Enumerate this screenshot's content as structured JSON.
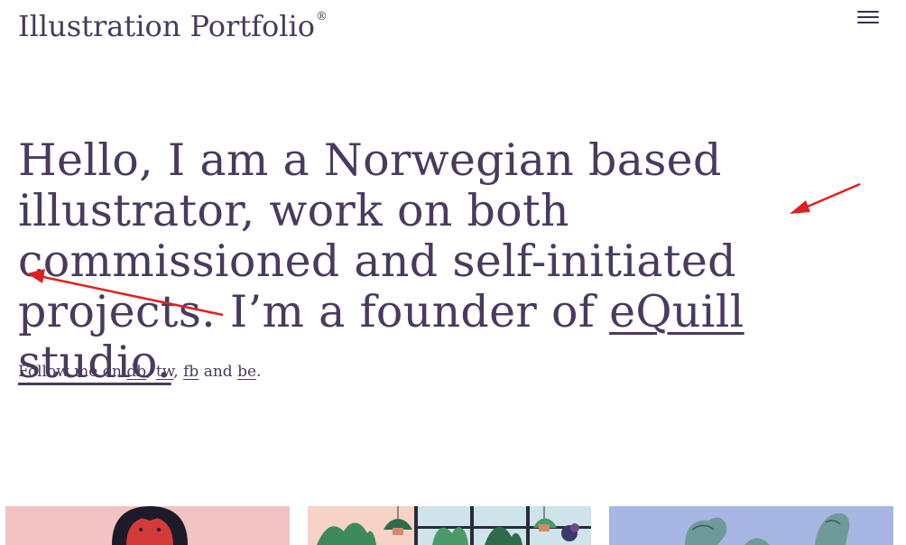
{
  "header": {
    "logo_text": "Illustration Portfolio",
    "logo_mark": "®",
    "menu_icon": "hamburger-menu-icon"
  },
  "intro": {
    "text_before_link": "Hello, I am a Norwegian based illustrator, work on both commissioned and self-initiated projects. I’m a founder of ",
    "studio_link": "eQuill studio.",
    "follow": {
      "prefix": "Follow me on ",
      "links": [
        "db",
        "tw",
        "fb",
        "be"
      ],
      "sep_comma": ", ",
      "sep_and": " and ",
      "suffix": "."
    }
  },
  "annotations": {
    "arrow_color": "#e02020"
  },
  "gallery": {
    "items": [
      {
        "name": "portrait-illustration",
        "bg": "#f2c3c3"
      },
      {
        "name": "hanging-plants-illustration",
        "bg": "#f7d2c6"
      },
      {
        "name": "arm-illustration",
        "bg": "#a7b6e3"
      }
    ]
  },
  "colors": {
    "text": "#4a3a5e",
    "background": "#ffffff"
  }
}
